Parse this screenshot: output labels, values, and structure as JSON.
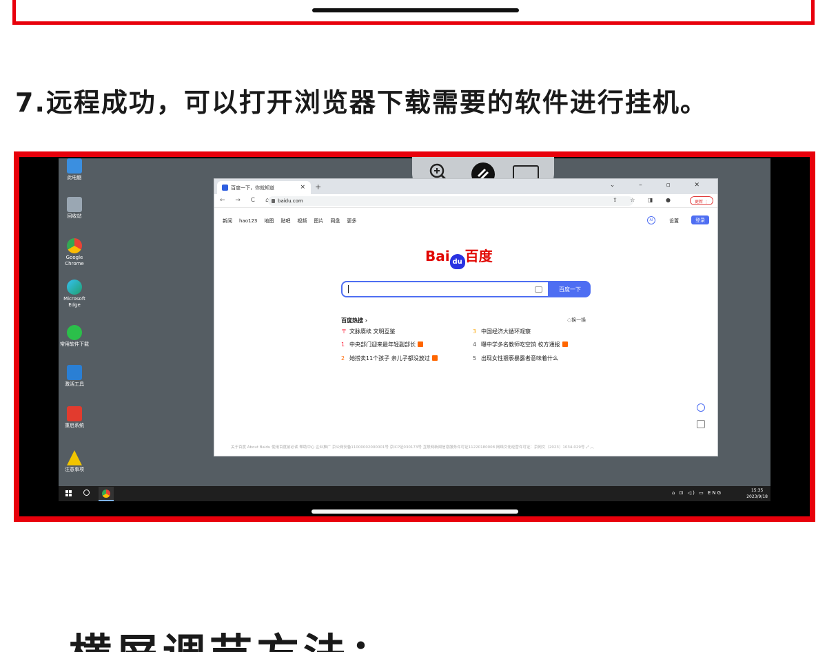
{
  "step_heading": "7.远程成功，可以打开浏览器下载需要的软件进行挂机。",
  "bottom_heading": "横屏调节方法：",
  "desktop_icons": [
    {
      "label": "此电脑",
      "color": "#3b8fe0"
    },
    {
      "label": "回收站",
      "color": "#9aa7b3"
    },
    {
      "label": "Google Chrome",
      "color": "#e34133"
    },
    {
      "label": "Microsoft Edge",
      "color": "#1f9f6f"
    },
    {
      "label": "常用软件下载",
      "color": "#2bbf4a"
    },
    {
      "label": "激活工具",
      "color": "#2a7fd4"
    },
    {
      "label": "重启系统",
      "color": "#e23b2e"
    },
    {
      "label": "注意事项",
      "color": "#f2c500"
    }
  ],
  "browser": {
    "tab_title": "百度一下，你就知道",
    "tab_close": "×",
    "new_tab": "+",
    "window_controls": "⌄ – ▫ ✕",
    "nav_buttons": "← → C ⌂",
    "url": "baidu.com",
    "toolbar_icons": "⇪ ☆ ◨ ●",
    "update_label": "更新 ⋮"
  },
  "baidu": {
    "nav_links": [
      "新闻",
      "hao123",
      "地图",
      "贴吧",
      "视频",
      "图片",
      "网盘",
      "更多"
    ],
    "ai_label": "AI",
    "settings": "设置",
    "login": "登录",
    "logo_left": "Bai",
    "logo_paw": "du",
    "logo_right": "百度",
    "search_button": "百度一下",
    "hot_title": "百度热搜 ›",
    "hot_refresh": "◌换一换",
    "hot_list": [
      {
        "rank": "〒",
        "text": "文脉赓续 文明互鉴",
        "tag": false
      },
      {
        "rank": "1",
        "text": "中央部门迎来最年轻副部长",
        "tag": true
      },
      {
        "rank": "2",
        "text": "她捞卖11个孩子 亲儿子都没放过",
        "tag": true
      },
      {
        "rank": "3",
        "text": "中国经济大循环观察",
        "tag": false
      },
      {
        "rank": "4",
        "text": "曝中学多名教师吃空饷 校方通报",
        "tag": true
      },
      {
        "rank": "5",
        "text": "出现女性猥亵暴露者意味着什么",
        "tag": false
      }
    ],
    "footer": "关于百度  About Baidu  使用百度前必读  帮助中心  企业推广  京公网安备11000002000001号  京ICP证030173号  互联网新闻信息服务许可证11220180008  网络文化经营许可证：京网文〔2023〕1034-029号  ⤢  ︿"
  },
  "taskbar": {
    "tray": "⌂ ⊡ ◁) ▭ ENG",
    "time": "15:35",
    "date": "2023/9/18"
  }
}
